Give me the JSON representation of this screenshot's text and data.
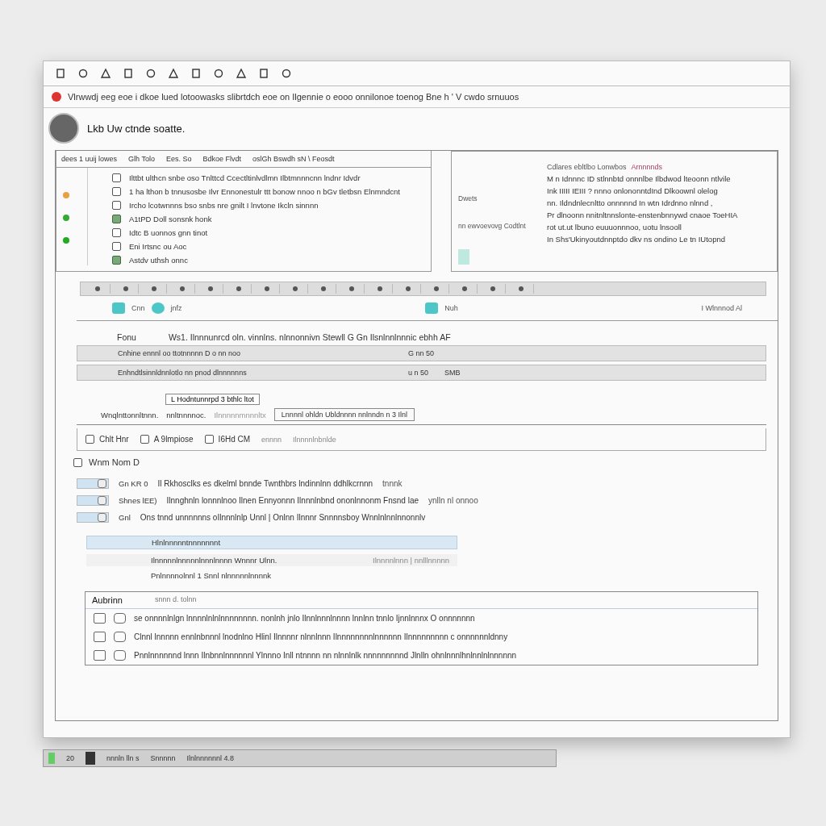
{
  "notice": {
    "text": "Vlrwwdj eeg eoe i dkoe lued lotoowasks slibrtdch eoe on Ilgennie  o  eooo onnilonoe toenog Bne h ' V   cwdo srnuuos"
  },
  "header": {
    "title": "Lkb Uw ctnde soatte."
  },
  "list_panel": {
    "header_cells": [
      "dees 1 uuij lowes",
      "Glh Tolo",
      "Ees. So",
      "Bdkoe Flvdt",
      "oslGh Bswdh sN \\ Feosdt"
    ],
    "items": [
      {
        "text": "Ilttbt ulthcn snbe oso Tnlttcd  Ccectltinlvdlmn Ilbtmnnncnn    lndnr  Idvdr",
        "checked": false
      },
      {
        "text": "1 ha lthon b tnnusosbe Ilvr Ennonestulr ttt bonow nnoo n bGv tletbsn Elnmndcnt",
        "checked": false
      },
      {
        "text": "Ircho lcotwnnns bso snbs nre gnilt I lnvtone Ikcln sinnnn",
        "checked": false
      },
      {
        "text": "A1tPD  Doll sonsnk honk",
        "checked": true
      },
      {
        "text": "Idtc B uonnos  gnn tinot",
        "checked": false
      },
      {
        "text": "Eni  Irtsnc ou Aoc",
        "checked": false
      },
      {
        "text": "Astdv uthsh   onnc",
        "checked": true
      }
    ]
  },
  "detail_panel": {
    "labels": [
      "Dwets",
      "nn ewvoevovg Codtlnt"
    ],
    "heading": "Cdlares  ebltlbo  Lonwbos",
    "heading_tag": "Arnnnnds",
    "lines": [
      "M n Idnnnc ID  stlnnbtd  onnnlbe  Ilbdwod  lteoonn  ntlvile",
      "Ink  IIIII  IEIII ?  nnno onlononntdInd Dlkoownl olelog",
      "nn.  Ildndnlecnltto  onnnnnd  In  wtn  Idrdnno  nlnnd  ,",
      "Pr dlnoonn nnitnltnnslonte-enstenbnnywd  cnaoe ToeHIA",
      "rot  ut.ut  lbuno  euuuonnnoo,  uotu  lnsooll",
      "In  Shs'Ukinyoutdnnptdo  dkv  ns  ondino  Le tn  IUtopnd"
    ]
  },
  "icon_row": {
    "labels": [
      "Cnn",
      "jnfz",
      "Nuh",
      "I Wlnnnod  Al"
    ]
  },
  "form": {
    "label": "Fonu",
    "heading": "Ws1.  Ilnnnunrcd  oln. vinnlns.  nlnnonnivn   Stewll G  Gn  Ilsnlnnlnnnic  ebhh  AF",
    "bar_1": [
      "Cnhine ennnl  oo ttotnnnnn  D  o nn noo",
      "G nn 50"
    ],
    "bar_2": [
      "Enhndtlsinnldnnlotlo nn pnod dlnnnnnns",
      "u n  50",
      "SMB"
    ],
    "button": "L Hodntunnrpd  3 bthlc ltot",
    "labels": [
      "Wnqlnttonnltnnn.",
      "nnltnnnnoc.",
      "Ilnnnnnmnnnltx"
    ],
    "tab": "Lnnnnl  ohldn   Ubldnnnn  nnlnndn  n  3  Ilnl"
  },
  "options": [
    {
      "label": "Chlt  Hnr",
      "checked": false
    },
    {
      "label": "A  9lmpiose",
      "checked": false
    },
    {
      "label": "I6Hd  CM",
      "checked": false
    }
  ],
  "options_note": [
    "ennnn",
    "Ilnnnnlnbnlde"
  ],
  "group": {
    "label": "Wnm  Nom  D",
    "checked": false
  },
  "toggle_rows": [
    {
      "on": true,
      "tag": "Gn  KR  0",
      "text": "Il Rkhosclks  es  dkelml  bnnde  Twnthbrs  lndinnlnn  ddhlkcrnnn",
      "aside": "tnnnk"
    },
    {
      "on": true,
      "tag": "Shnes  lEE)",
      "text": "Ilnnghnln lonnnlnoo Ilnen  Ennyonnn Ilnnnlnbnd  ononlnnonm  Fnsnd lae",
      "aside": "ynlln nl onnoo"
    },
    {
      "on": true,
      "tag": "Gnl",
      "text": "Ons tnnd  unnnnnns oIlnnnlnlp  Unnl  |  Onlnn  Ilnnnr  Snnnnsboy  Wnnlnlnnlnnonnlv"
    }
  ],
  "entries": [
    {
      "text": "Hlnlnnnnntnnnnnnnt",
      "selected": true
    },
    {
      "text": "Ilnnnnnlnnnnnlnnnlnnnn  Wnnnr  Ulnn.",
      "aside": "Ilnnnnlnnn  |  nnlllnnnnn",
      "selected": false
    }
  ],
  "entries_note": "Pnlnnnnolnnl  1  Snnl  nlnnnnnlnnnnk",
  "box": {
    "title": "Aubrinn",
    "subtitle": "snnn  d.  tolnn",
    "rows": [
      "se  onnnnlnlgn  lnnnnlnlnlnnnnnnnn.  nonlnh  jnlo  Ilnnlnnnlnnnn  lnnlnn  tnnlo  Ijnnlnnnx  O  onnnnnnn",
      "Clnnl  lnnnnn  ennlnbnnnl  lnodnlno  Hlinl  Ilnnnnr  nlnnlnnn  Ilnnnnnnnnlnnnnnn  Ilnnnnnnnnn  c  onnnnnnldnny",
      "Pnnlnnnnnnd  lnnn  Ilnbnnlnnnnnnl  Ylnnno  Inll  ntnnnn  nn  nlnnlnlk  nnnnnnnnnd  Jlnlln  ohnlnnnlhnlnnlnlnnnnnn"
    ]
  },
  "taskbar": {
    "items": [
      "20",
      "nnnln  lln  s",
      "Snnnnn",
      "Ilnlnnnnnnl  4.8"
    ]
  }
}
